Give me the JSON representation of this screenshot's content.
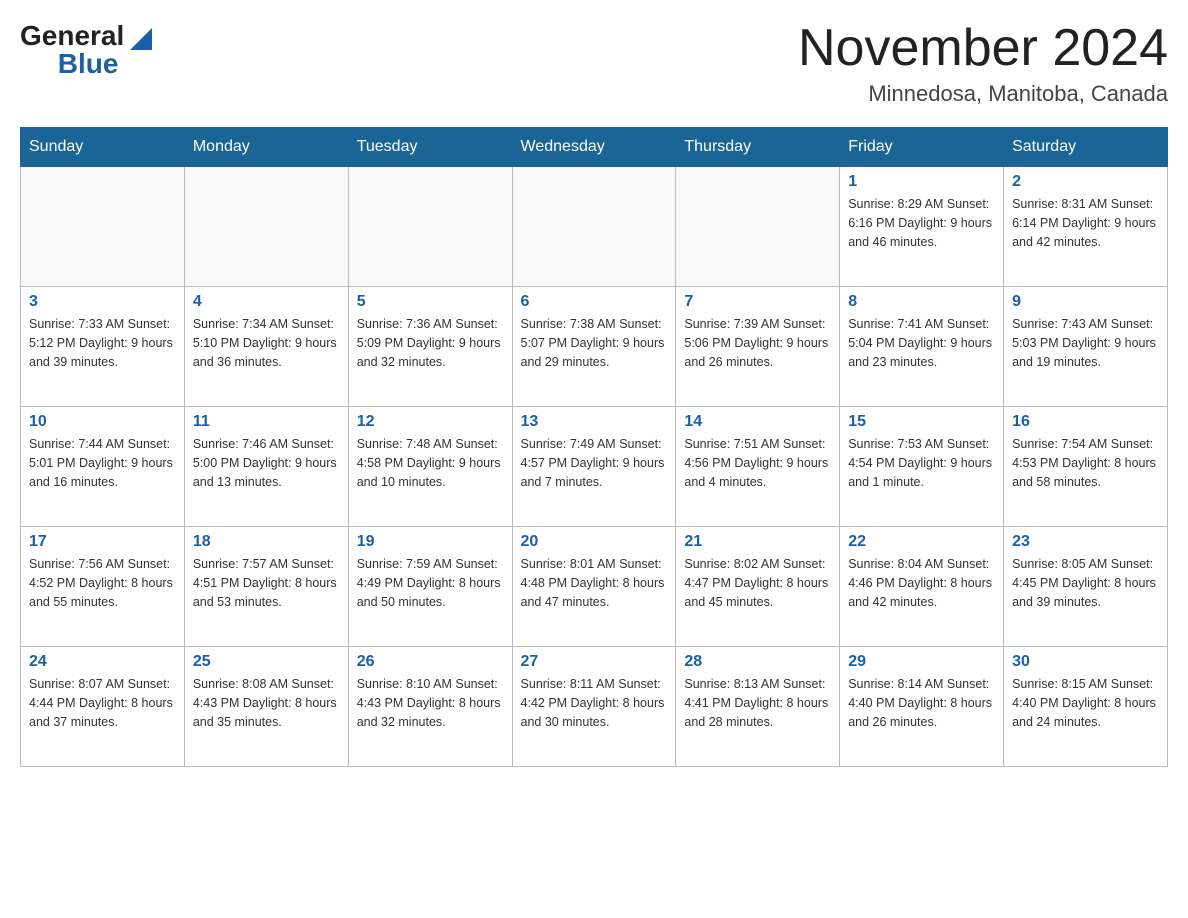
{
  "header": {
    "logo_general": "General",
    "logo_blue": "Blue",
    "month": "November 2024",
    "location": "Minnedosa, Manitoba, Canada"
  },
  "weekdays": [
    "Sunday",
    "Monday",
    "Tuesday",
    "Wednesday",
    "Thursday",
    "Friday",
    "Saturday"
  ],
  "weeks": [
    [
      {
        "day": "",
        "info": ""
      },
      {
        "day": "",
        "info": ""
      },
      {
        "day": "",
        "info": ""
      },
      {
        "day": "",
        "info": ""
      },
      {
        "day": "",
        "info": ""
      },
      {
        "day": "1",
        "info": "Sunrise: 8:29 AM\nSunset: 6:16 PM\nDaylight: 9 hours and 46 minutes."
      },
      {
        "day": "2",
        "info": "Sunrise: 8:31 AM\nSunset: 6:14 PM\nDaylight: 9 hours and 42 minutes."
      }
    ],
    [
      {
        "day": "3",
        "info": "Sunrise: 7:33 AM\nSunset: 5:12 PM\nDaylight: 9 hours and 39 minutes."
      },
      {
        "day": "4",
        "info": "Sunrise: 7:34 AM\nSunset: 5:10 PM\nDaylight: 9 hours and 36 minutes."
      },
      {
        "day": "5",
        "info": "Sunrise: 7:36 AM\nSunset: 5:09 PM\nDaylight: 9 hours and 32 minutes."
      },
      {
        "day": "6",
        "info": "Sunrise: 7:38 AM\nSunset: 5:07 PM\nDaylight: 9 hours and 29 minutes."
      },
      {
        "day": "7",
        "info": "Sunrise: 7:39 AM\nSunset: 5:06 PM\nDaylight: 9 hours and 26 minutes."
      },
      {
        "day": "8",
        "info": "Sunrise: 7:41 AM\nSunset: 5:04 PM\nDaylight: 9 hours and 23 minutes."
      },
      {
        "day": "9",
        "info": "Sunrise: 7:43 AM\nSunset: 5:03 PM\nDaylight: 9 hours and 19 minutes."
      }
    ],
    [
      {
        "day": "10",
        "info": "Sunrise: 7:44 AM\nSunset: 5:01 PM\nDaylight: 9 hours and 16 minutes."
      },
      {
        "day": "11",
        "info": "Sunrise: 7:46 AM\nSunset: 5:00 PM\nDaylight: 9 hours and 13 minutes."
      },
      {
        "day": "12",
        "info": "Sunrise: 7:48 AM\nSunset: 4:58 PM\nDaylight: 9 hours and 10 minutes."
      },
      {
        "day": "13",
        "info": "Sunrise: 7:49 AM\nSunset: 4:57 PM\nDaylight: 9 hours and 7 minutes."
      },
      {
        "day": "14",
        "info": "Sunrise: 7:51 AM\nSunset: 4:56 PM\nDaylight: 9 hours and 4 minutes."
      },
      {
        "day": "15",
        "info": "Sunrise: 7:53 AM\nSunset: 4:54 PM\nDaylight: 9 hours and 1 minute."
      },
      {
        "day": "16",
        "info": "Sunrise: 7:54 AM\nSunset: 4:53 PM\nDaylight: 8 hours and 58 minutes."
      }
    ],
    [
      {
        "day": "17",
        "info": "Sunrise: 7:56 AM\nSunset: 4:52 PM\nDaylight: 8 hours and 55 minutes."
      },
      {
        "day": "18",
        "info": "Sunrise: 7:57 AM\nSunset: 4:51 PM\nDaylight: 8 hours and 53 minutes."
      },
      {
        "day": "19",
        "info": "Sunrise: 7:59 AM\nSunset: 4:49 PM\nDaylight: 8 hours and 50 minutes."
      },
      {
        "day": "20",
        "info": "Sunrise: 8:01 AM\nSunset: 4:48 PM\nDaylight: 8 hours and 47 minutes."
      },
      {
        "day": "21",
        "info": "Sunrise: 8:02 AM\nSunset: 4:47 PM\nDaylight: 8 hours and 45 minutes."
      },
      {
        "day": "22",
        "info": "Sunrise: 8:04 AM\nSunset: 4:46 PM\nDaylight: 8 hours and 42 minutes."
      },
      {
        "day": "23",
        "info": "Sunrise: 8:05 AM\nSunset: 4:45 PM\nDaylight: 8 hours and 39 minutes."
      }
    ],
    [
      {
        "day": "24",
        "info": "Sunrise: 8:07 AM\nSunset: 4:44 PM\nDaylight: 8 hours and 37 minutes."
      },
      {
        "day": "25",
        "info": "Sunrise: 8:08 AM\nSunset: 4:43 PM\nDaylight: 8 hours and 35 minutes."
      },
      {
        "day": "26",
        "info": "Sunrise: 8:10 AM\nSunset: 4:43 PM\nDaylight: 8 hours and 32 minutes."
      },
      {
        "day": "27",
        "info": "Sunrise: 8:11 AM\nSunset: 4:42 PM\nDaylight: 8 hours and 30 minutes."
      },
      {
        "day": "28",
        "info": "Sunrise: 8:13 AM\nSunset: 4:41 PM\nDaylight: 8 hours and 28 minutes."
      },
      {
        "day": "29",
        "info": "Sunrise: 8:14 AM\nSunset: 4:40 PM\nDaylight: 8 hours and 26 minutes."
      },
      {
        "day": "30",
        "info": "Sunrise: 8:15 AM\nSunset: 4:40 PM\nDaylight: 8 hours and 24 minutes."
      }
    ]
  ]
}
